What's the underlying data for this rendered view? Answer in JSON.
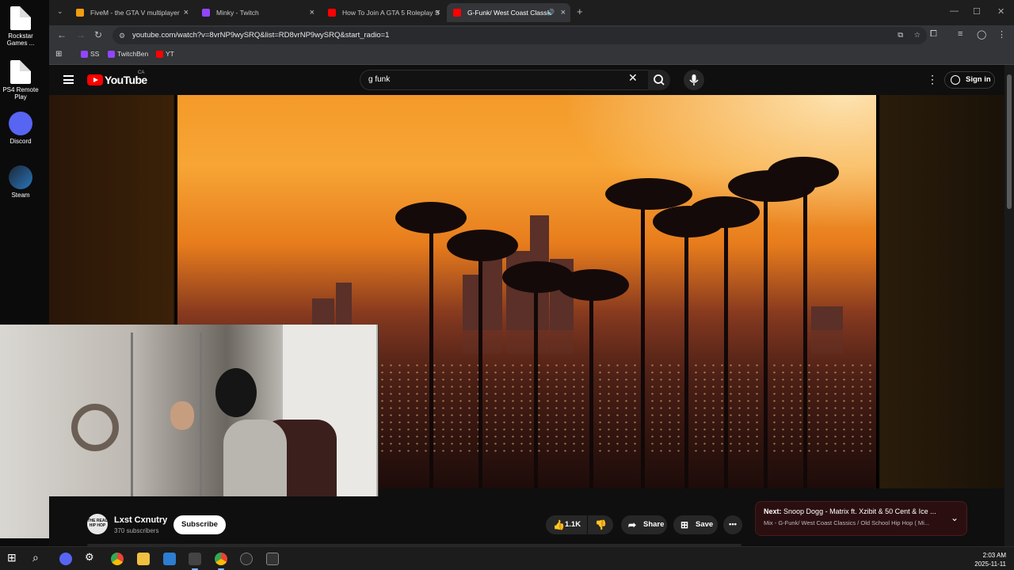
{
  "desktop": {
    "icons": [
      {
        "label": "Rockstar Games ...",
        "icon": "file-icon"
      },
      {
        "label": "PS4 Remote Play",
        "icon": "file-icon"
      },
      {
        "label": "Discord",
        "icon": "discord-icon"
      },
      {
        "label": "Steam",
        "icon": "steam-icon"
      }
    ]
  },
  "browser": {
    "tabs": [
      {
        "title": "FiveM - the GTA V multiplayer",
        "icon_color": "#f39c12"
      },
      {
        "title": "Minky - Twitch",
        "icon_color": "#9146ff"
      },
      {
        "title": "How To Join A GTA 5 Roleplay S",
        "icon_color": "#ff0000"
      },
      {
        "title": "G-Funk/ West Coast Classic",
        "icon_color": "#ff0000",
        "active": true
      }
    ],
    "url": "youtube.com/watch?v=8vrNP9wySRQ&list=RD8vrNP9wySRQ&start_radio=1",
    "bookmarks": [
      {
        "label": "SS",
        "color": "#9146ff"
      },
      {
        "label": "TwitchBen",
        "color": "#9146ff"
      },
      {
        "label": "YT",
        "color": "#ff0000"
      }
    ]
  },
  "youtube": {
    "logo_text": "YouTube",
    "country": "CA",
    "search_value": "g funk",
    "signin_label": "Sign in",
    "channel": {
      "name": "Lxst Cxnutry",
      "subscribers": "370 subscribers",
      "avatar_text": "THE REAL HIP HOP"
    },
    "subscribe_label": "Subscribe",
    "likes": "1.1K",
    "share_label": "Share",
    "save_label": "Save",
    "next": {
      "prefix": "Next:",
      "title": "Snoop Dogg - Matrix ft. Xzibit & 50 Cent & Ice ...",
      "playlist": "Mix - G-Funk/ West Coast Classics / Old School Hip Hop ( Mi..."
    }
  },
  "taskbar": {
    "time": "2:03 AM",
    "date": "2025-11-11"
  }
}
